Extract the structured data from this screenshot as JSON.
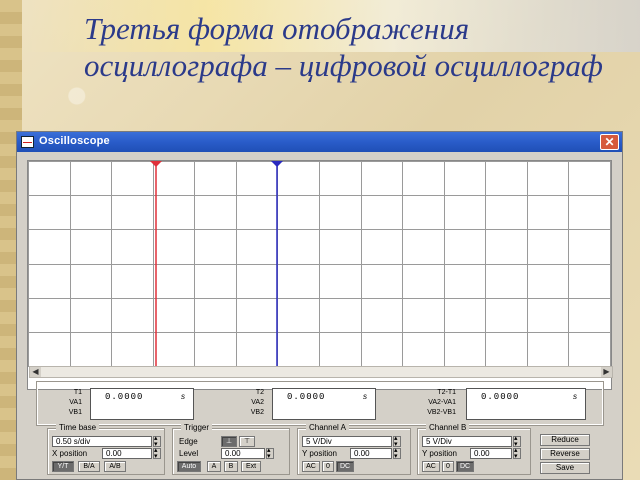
{
  "slide": {
    "title": "Третья форма отображения осциллографа – цифровой осциллограф"
  },
  "window": {
    "title": "Oscilloscope",
    "close_label": "✕"
  },
  "cursors": {
    "t1_color": "#e0303a",
    "t2_color": "#2a2ac0"
  },
  "readouts": [
    {
      "labels": [
        "T1",
        "VA1",
        "VB1"
      ],
      "value": "0.0000",
      "unit": "s"
    },
    {
      "labels": [
        "T2",
        "VA2",
        "VB2"
      ],
      "value": "0.0000",
      "unit": "s"
    },
    {
      "labels": [
        "T2-T1",
        "VA2-VA1",
        "VB2-VB1"
      ],
      "value": "0.0000",
      "unit": "s"
    }
  ],
  "timebase": {
    "title": "Time base",
    "scale": "0.50 s/div",
    "xpos_label": "X position",
    "xpos_value": "0.00",
    "modes": [
      "Y/T",
      "B/A",
      "A/B"
    ]
  },
  "trigger": {
    "title": "Trigger",
    "edge_label": "Edge",
    "level_label": "Level",
    "level_value": "0.00",
    "modes": [
      "Auto",
      "A",
      "B",
      "Ext"
    ]
  },
  "channel_a": {
    "title": "Channel A",
    "scale": "5 V/Div",
    "ypos_label": "Y position",
    "ypos_value": "0.00",
    "coupling": [
      "AC",
      "0",
      "DC"
    ]
  },
  "channel_b": {
    "title": "Channel B",
    "scale": "5 V/Div",
    "ypos_label": "Y position",
    "ypos_value": "0.00",
    "coupling": [
      "AC",
      "0",
      "DC"
    ]
  },
  "actions": {
    "reduce": "Reduce",
    "reverse": "Reverse",
    "save": "Save"
  }
}
